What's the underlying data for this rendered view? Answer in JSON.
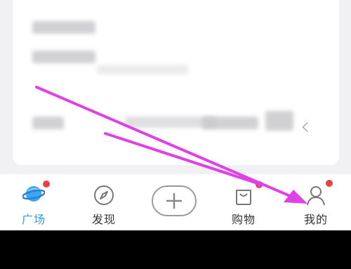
{
  "tabs": [
    {
      "label": "广场",
      "icon": "planet-icon",
      "active": true,
      "badge": true
    },
    {
      "label": "发现",
      "icon": "compass-icon",
      "active": false,
      "badge": false
    },
    {
      "label": "",
      "icon": "plus-icon",
      "active": false,
      "badge": false
    },
    {
      "label": "购物",
      "icon": "shopping-bag-icon",
      "active": false,
      "badge": true
    },
    {
      "label": "我的",
      "icon": "person-icon",
      "active": false,
      "badge": true
    }
  ],
  "colors": {
    "accent": "#2f9cf0",
    "badge": "#e64340",
    "annotation_arrow": "#e040e8"
  }
}
